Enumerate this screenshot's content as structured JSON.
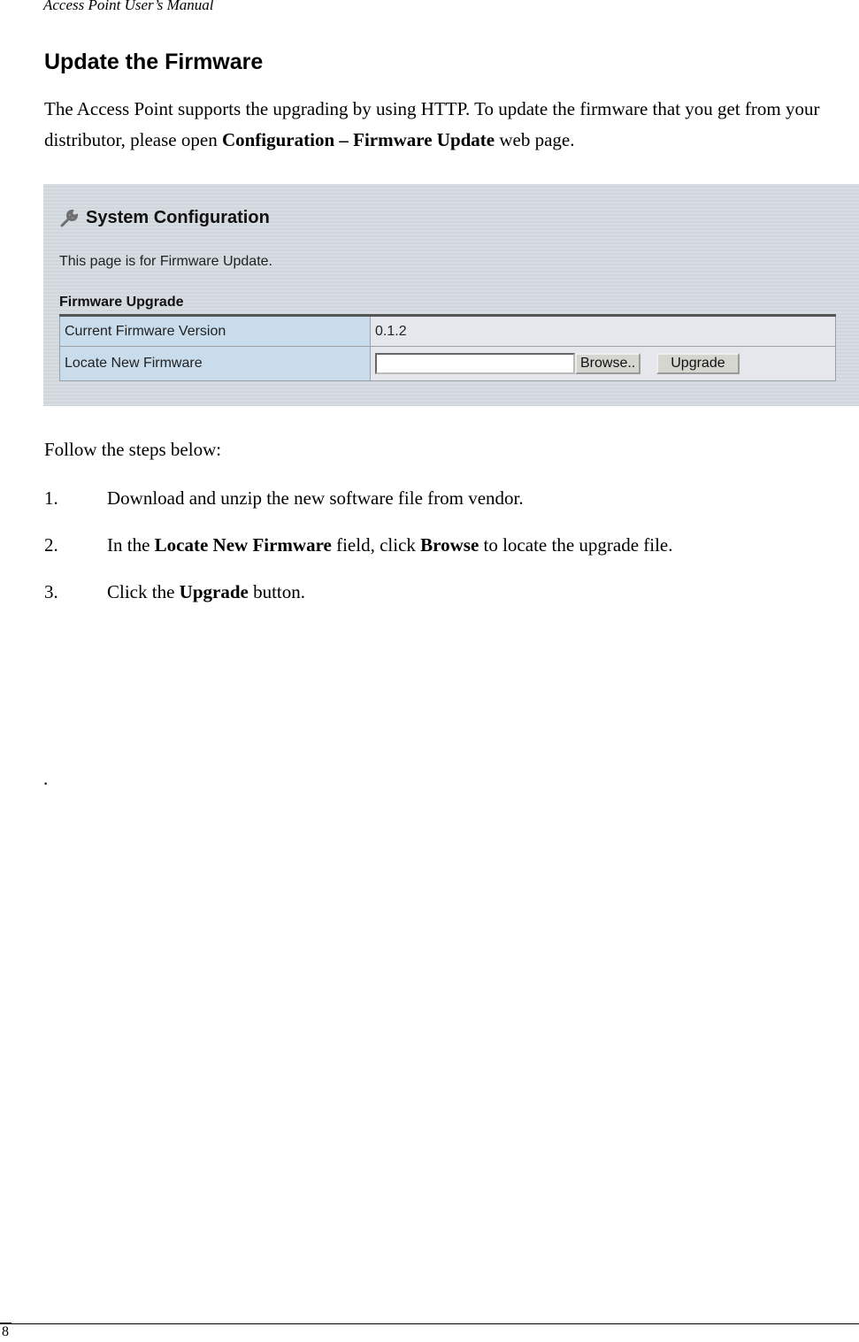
{
  "header": {
    "running_title": "Access Point User’s Manual"
  },
  "section": {
    "title": "Update the Firmware",
    "intro_part1": "The Access Point supports the upgrading by using HTTP.    To update the firmware that you get from your distributor, please open ",
    "intro_bold": "Configuration – Firmware Update",
    "intro_part2": " web page."
  },
  "screenshot": {
    "title": "System Configuration",
    "title_icon": "wrench-icon",
    "description": "This page is for Firmware Update.",
    "subsection": "Firmware Upgrade",
    "rows": [
      {
        "label": "Current Firmware Version",
        "value": "0.1.2"
      },
      {
        "label": "Locate New Firmware",
        "file_value": "",
        "browse_label": "Browse..",
        "upgrade_label": "Upgrade"
      }
    ]
  },
  "steps_intro": "Follow the steps below:",
  "steps": [
    {
      "num": "1.",
      "pre": "Download and unzip the new software file from vendor.",
      "bold": "",
      "mid": "",
      "bold2": "",
      "post": ""
    },
    {
      "num": "2.",
      "pre": "In the ",
      "bold": "Locate New Firmware",
      "mid": " field, click ",
      "bold2": "Browse",
      "post": " to locate the upgrade file."
    },
    {
      "num": "3.",
      "pre": "Click the ",
      "bold": "Upgrade",
      "mid": " button.",
      "bold2": "",
      "post": ""
    }
  ],
  "stray_mark": ".",
  "footer": {
    "page_number": "8"
  }
}
